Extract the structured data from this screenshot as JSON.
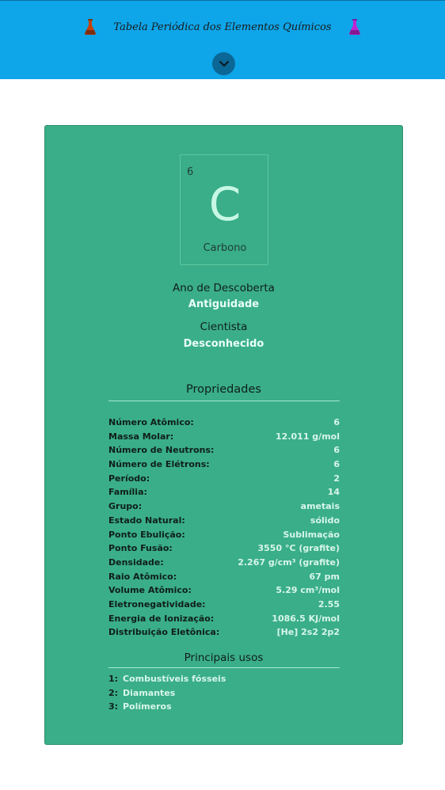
{
  "header": {
    "title": "Tabela Periódica dos Elementos Químicos",
    "icons": [
      "flask-left-icon",
      "flask-right-icon",
      "chevron-down-icon"
    ],
    "colors": {
      "background": "#0ea5e9",
      "toggle": "#0b6796"
    }
  },
  "element": {
    "number": "6",
    "symbol": "C",
    "name": "Carbono",
    "discovery_label": "Ano de Descoberta",
    "discovery_value": "Antiguidade",
    "scientist_label": "Cientista",
    "scientist_value": "Desconhecido",
    "card_color": "#3aae88"
  },
  "properties": {
    "title": "Propriedades",
    "rows": [
      {
        "label": "Número Atômico:",
        "value": "6"
      },
      {
        "label": "Massa Molar:",
        "value": "12.011 g/mol"
      },
      {
        "label": "Número de Neutrons:",
        "value": "6"
      },
      {
        "label": "Número de Elétrons:",
        "value": "6"
      },
      {
        "label": "Período:",
        "value": "2"
      },
      {
        "label": "Família:",
        "value": "14"
      },
      {
        "label": "Grupo:",
        "value": "ametais"
      },
      {
        "label": "Estado Natural:",
        "value": "sólido"
      },
      {
        "label": "Ponto Ebulição:",
        "value": "Sublimação"
      },
      {
        "label": "Ponto Fusão:",
        "value": "3550 °C (grafite)"
      },
      {
        "label": "Densidade:",
        "value": "2.267 g/cm³ (grafite)"
      },
      {
        "label": "Raio Atômico:",
        "value": "67 pm"
      },
      {
        "label": "Volume Atômico:",
        "value": "5.29 cm³/mol"
      },
      {
        "label": "Eletronegatividade:",
        "value": "2.55"
      },
      {
        "label": "Energia de Ionização:",
        "value": "1086.5 KJ/mol"
      },
      {
        "label": "Distribuição Eletônica:",
        "value": "[He] 2s2 2p2"
      }
    ]
  },
  "uses": {
    "title": "Principais usos",
    "items": [
      {
        "num": "1:",
        "label": "Combustíveis fósseis"
      },
      {
        "num": "2:",
        "label": "Diamantes"
      },
      {
        "num": "3:",
        "label": "Polímeros"
      }
    ]
  }
}
